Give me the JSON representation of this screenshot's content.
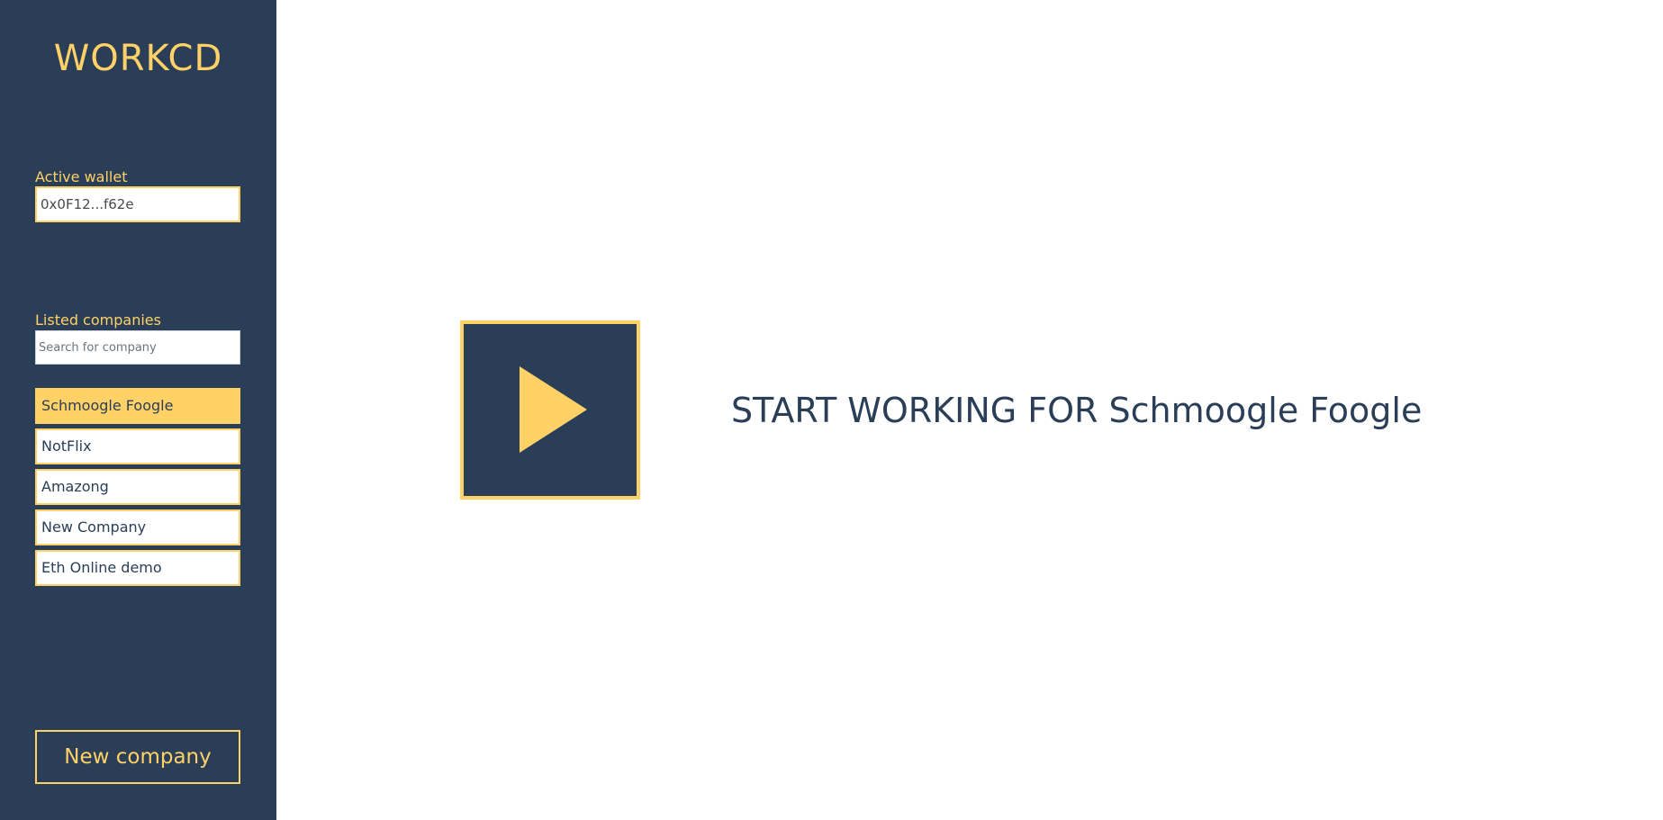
{
  "app": {
    "logo": "WORKCD"
  },
  "colors": {
    "sidebar_bg": "#2a3e57",
    "accent": "#ffd166",
    "text_dark": "#2a3e57"
  },
  "wallet": {
    "label": "Active wallet",
    "value": "0x0F12...f62e"
  },
  "companies": {
    "label": "Listed companies",
    "search_placeholder": "Search for company",
    "items": [
      {
        "label": "Schmoogle Foogle",
        "active": true
      },
      {
        "label": "NotFlix",
        "active": false
      },
      {
        "label": "Amazong",
        "active": false
      },
      {
        "label": "New Company",
        "active": false
      },
      {
        "label": "Eth Online demo",
        "active": false
      }
    ],
    "new_button_label": "New company"
  },
  "main": {
    "play_icon": "play-icon",
    "start_prefix": "START WORKING FOR",
    "selected_company": "Schmoogle Foogle"
  }
}
